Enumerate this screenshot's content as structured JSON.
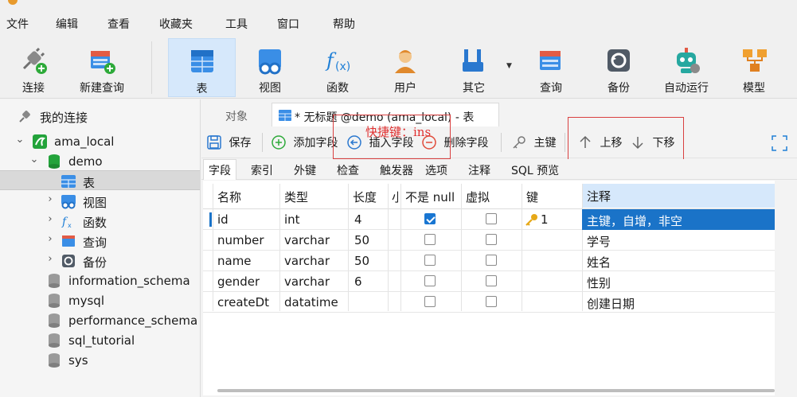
{
  "menu": {
    "items": [
      "文件",
      "编辑",
      "查看",
      "收藏夹",
      "工具",
      "窗口",
      "帮助"
    ]
  },
  "toolbar": {
    "items": [
      {
        "label": "连接",
        "icon": "connect-icon"
      },
      {
        "label": "新建查询",
        "icon": "new-query-icon"
      },
      {
        "label": "表",
        "icon": "table-icon"
      },
      {
        "label": "视图",
        "icon": "view-icon"
      },
      {
        "label": "函数",
        "icon": "function-icon"
      },
      {
        "label": "用户",
        "icon": "user-icon"
      },
      {
        "label": "其它",
        "icon": "tools-icon"
      },
      {
        "label": "查询",
        "icon": "query-icon"
      },
      {
        "label": "备份",
        "icon": "backup-icon"
      },
      {
        "label": "自动运行",
        "icon": "robot-icon"
      },
      {
        "label": "模型",
        "icon": "model-icon"
      }
    ]
  },
  "tree": {
    "root": "我的连接",
    "connection": "ama_local",
    "database": "demo",
    "children": [
      "表",
      "视图",
      "函数",
      "查询",
      "备份"
    ],
    "databases": [
      "information_schema",
      "mysql",
      "performance_schema",
      "sql_tutorial",
      "sys"
    ]
  },
  "tabs": {
    "objects": "对象",
    "current": "* 无标题 @demo (ama_local) - 表"
  },
  "subtoolbar": {
    "save": "保存",
    "add_field": "添加字段",
    "insert_field": "插入字段",
    "delete_field": "删除字段",
    "primary_key": "主键",
    "move_up": "上移",
    "move_down": "下移",
    "tip": "快捷键：ins"
  },
  "props_tabs": [
    "字段",
    "索引",
    "外键",
    "检查",
    "触发器",
    "选项",
    "注释",
    "SQL 预览"
  ],
  "grid": {
    "headers": {
      "name": "名称",
      "type": "类型",
      "length": "长度",
      "decimal": "小",
      "not_null": "不是 null",
      "virtual": "虚拟",
      "key": "键",
      "comment": "注释"
    },
    "rows": [
      {
        "name": "id",
        "type": "int",
        "length": "4",
        "not_null": true,
        "virtual": false,
        "key": "1",
        "comment": "主键，自增，非空"
      },
      {
        "name": "number",
        "type": "varchar",
        "length": "50",
        "not_null": false,
        "virtual": false,
        "key": "",
        "comment": "学号"
      },
      {
        "name": "name",
        "type": "varchar",
        "length": "50",
        "not_null": false,
        "virtual": false,
        "key": "",
        "comment": "姓名"
      },
      {
        "name": "gender",
        "type": "varchar",
        "length": "6",
        "not_null": false,
        "virtual": false,
        "key": "",
        "comment": "性别"
      },
      {
        "name": "createDt",
        "type": "datatime",
        "length": "",
        "not_null": false,
        "virtual": false,
        "key": "",
        "comment": "创建日期"
      }
    ]
  },
  "colors": {
    "accent": "#1a73c8",
    "active_tool": "#d6e8fb",
    "highlight_box": "#d94040"
  }
}
